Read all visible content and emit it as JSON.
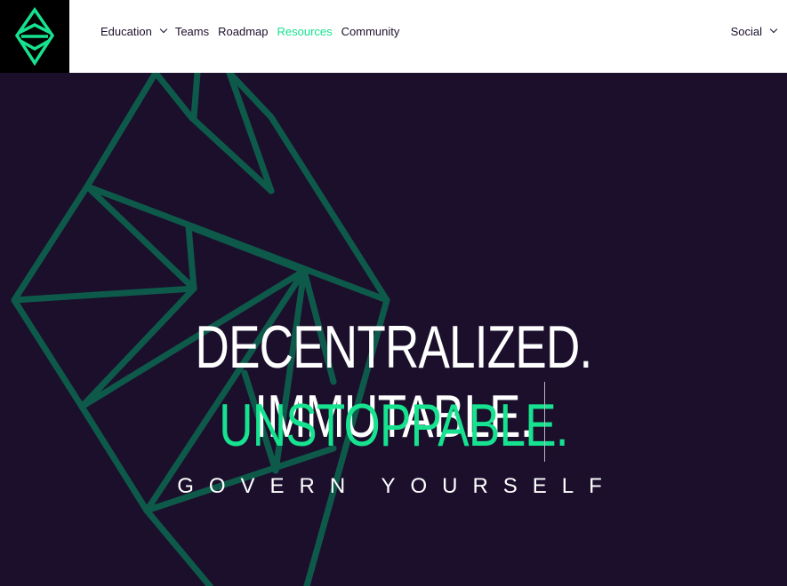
{
  "header": {
    "logo": "ethereum-classic-logo-icon",
    "nav": [
      {
        "label": "Education",
        "dropdown": true,
        "active": false
      },
      {
        "label": "Teams",
        "dropdown": false,
        "active": false
      },
      {
        "label": "Roadmap",
        "dropdown": false,
        "active": false
      },
      {
        "label": "Resources",
        "dropdown": false,
        "active": true
      },
      {
        "label": "Community",
        "dropdown": false,
        "active": false
      }
    ],
    "social": {
      "label": "Social",
      "dropdown": true
    }
  },
  "hero": {
    "line1": "DECENTRALIZED. IMMUTABLE.",
    "line2": "UNSTOPPABLE.",
    "tagline": "GOVERN YOURSELF"
  },
  "colors": {
    "accent": "#16e28f",
    "background": "#1b0f2c",
    "pattern": "#0e5a4a"
  }
}
